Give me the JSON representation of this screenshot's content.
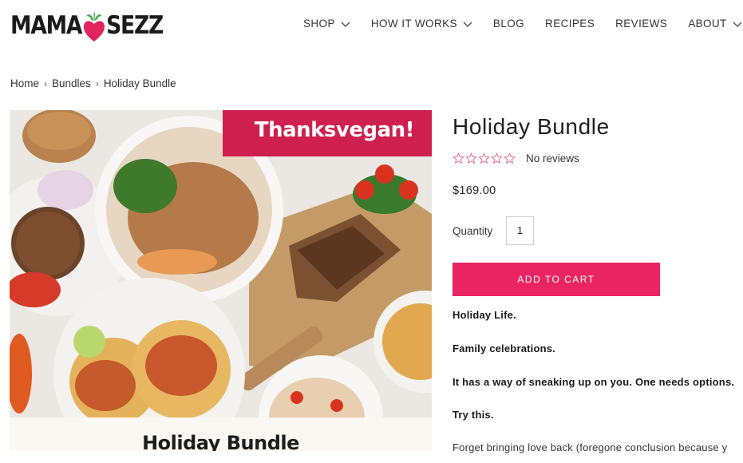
{
  "header": {
    "logo_left": "MAMA",
    "logo_right": "SEZZ",
    "nav": [
      {
        "label": "SHOP",
        "has_dropdown": true
      },
      {
        "label": "HOW IT WORKS",
        "has_dropdown": true
      },
      {
        "label": "BLOG",
        "has_dropdown": false
      },
      {
        "label": "RECIPES",
        "has_dropdown": false
      },
      {
        "label": "REVIEWS",
        "has_dropdown": false
      },
      {
        "label": "ABOUT",
        "has_dropdown": true
      }
    ]
  },
  "breadcrumb": [
    "Home",
    "Bundles",
    "Holiday Bundle"
  ],
  "image": {
    "banner_text": "Thanksvegan!",
    "caption": "Holiday Bundle"
  },
  "product": {
    "title": "Holiday Bundle",
    "rating": 0,
    "reviews_text": "No reviews",
    "price": "$169.00",
    "quantity_label": "Quantity",
    "quantity_value": "1",
    "add_to_cart": "ADD TO CART"
  },
  "description": [
    "Holiday Life.",
    "Family celebrations.",
    "It has a way of sneaking up on you. One needs options.",
    "Try this.",
    "Forget bringing love back (foregone conclusion because y"
  ],
  "colors": {
    "accent": "#ea2462",
    "banner": "#cf1f4f",
    "logo_heart": "#e0245e",
    "logo_leaf": "#4caf50"
  }
}
